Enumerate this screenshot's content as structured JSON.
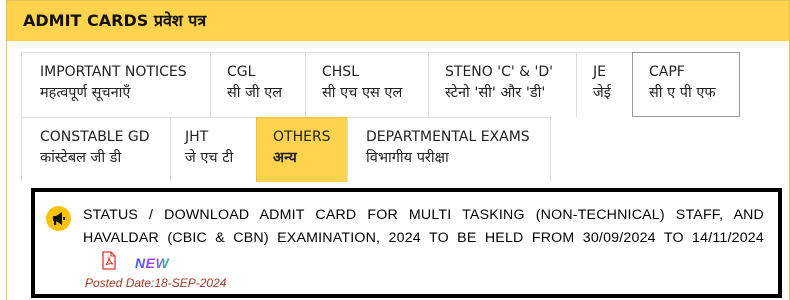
{
  "header": {
    "title": "ADMIT CARDS प्रवेश पत्र"
  },
  "tabs": [
    {
      "label_en": "IMPORTANT NOTICES",
      "label_hi": "महत्वपूर्ण सूचनाएँ"
    },
    {
      "label_en": "CGL",
      "label_hi": "सी जी एल"
    },
    {
      "label_en": "CHSL",
      "label_hi": "सी एच एस एल"
    },
    {
      "label_en": "STENO 'C' & 'D'",
      "label_hi": "स्टेनो 'सी' और 'डी'"
    },
    {
      "label_en": "JE",
      "label_hi": "जेई"
    },
    {
      "label_en": "CAPF",
      "label_hi": "सी ए पी एफ"
    },
    {
      "label_en": "CONSTABLE GD",
      "label_hi": "कांस्टेबल जी डी"
    },
    {
      "label_en": "JHT",
      "label_hi": "जे एच टी"
    },
    {
      "label_en": "OTHERS",
      "label_hi": "अन्य"
    },
    {
      "label_en": "DEPARTMENTAL EXAMS",
      "label_hi": "विभागीय परीक्षा"
    }
  ],
  "selected_tab": "OTHERS",
  "notice": {
    "icon": "megaphone-icon",
    "line1": "STATUS / DOWNLOAD ADMIT CARD FOR MULTI TASKING (NON-TECHNICAL) STAFF, AND",
    "line2": "HAVALDAR (CBIC & CBN) EXAMINATION, 2024 TO BE HELD FROM 30/09/2024 TO 14/11/2024",
    "attachment_icon": "pdf-icon",
    "new_badge": "NEW",
    "posted_date": "Posted Date:18-SEP-2024"
  },
  "colors": {
    "header_bg": "#ffd34d",
    "selected_tab_bg": "#ffd34d",
    "posted_date": "#a33a2a",
    "pdf": "#e53935"
  }
}
